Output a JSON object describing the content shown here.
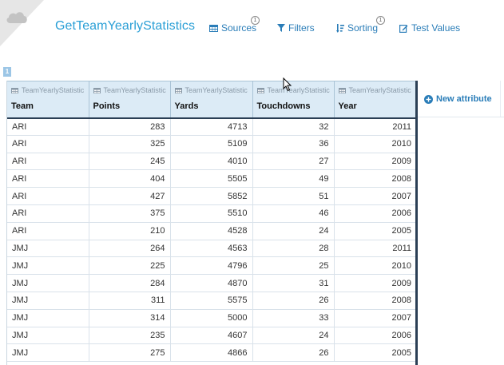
{
  "app": {
    "title": "GetTeamYearlyStatistics"
  },
  "toolbar": {
    "sources": {
      "label": "Sources",
      "badge": "1"
    },
    "filters": {
      "label": "Filters"
    },
    "sorting": {
      "label": "Sorting",
      "badge": "1"
    },
    "test_values": {
      "label": "Test Values"
    }
  },
  "grid": {
    "marker": "1",
    "source_name": "TeamYearlyStatistic",
    "columns": [
      "Team",
      "Points",
      "Yards",
      "Touchdowns",
      "Year"
    ],
    "rows": [
      [
        "ARI",
        "283",
        "4713",
        "32",
        "2011"
      ],
      [
        "ARI",
        "325",
        "5109",
        "36",
        "2010"
      ],
      [
        "ARI",
        "245",
        "4010",
        "27",
        "2009"
      ],
      [
        "ARI",
        "404",
        "5505",
        "49",
        "2008"
      ],
      [
        "ARI",
        "427",
        "5852",
        "51",
        "2007"
      ],
      [
        "ARI",
        "375",
        "5510",
        "46",
        "2006"
      ],
      [
        "ARI",
        "210",
        "4528",
        "24",
        "2005"
      ],
      [
        "JMJ",
        "264",
        "4563",
        "28",
        "2011"
      ],
      [
        "JMJ",
        "225",
        "4796",
        "25",
        "2010"
      ],
      [
        "JMJ",
        "284",
        "4870",
        "31",
        "2009"
      ],
      [
        "JMJ",
        "311",
        "5575",
        "26",
        "2008"
      ],
      [
        "JMJ",
        "314",
        "5000",
        "33",
        "2007"
      ],
      [
        "JMJ",
        "235",
        "4607",
        "24",
        "2006"
      ],
      [
        "JMJ",
        "275",
        "4866",
        "26",
        "2005"
      ]
    ]
  },
  "new_attribute": {
    "label": "New attribute"
  },
  "icons": {
    "logo": "cloud-icon",
    "sources": "table-icon",
    "filters": "funnel-icon",
    "sorting": "sort-icon",
    "test_values": "edit-icon",
    "new_attribute": "plus-circle-icon",
    "cursor": "cursor-icon"
  },
  "colors": {
    "accent": "#2a9fd6",
    "link": "#2a7db8",
    "header_bg": "#dcebf6",
    "grid_border": "#2b3f55"
  }
}
